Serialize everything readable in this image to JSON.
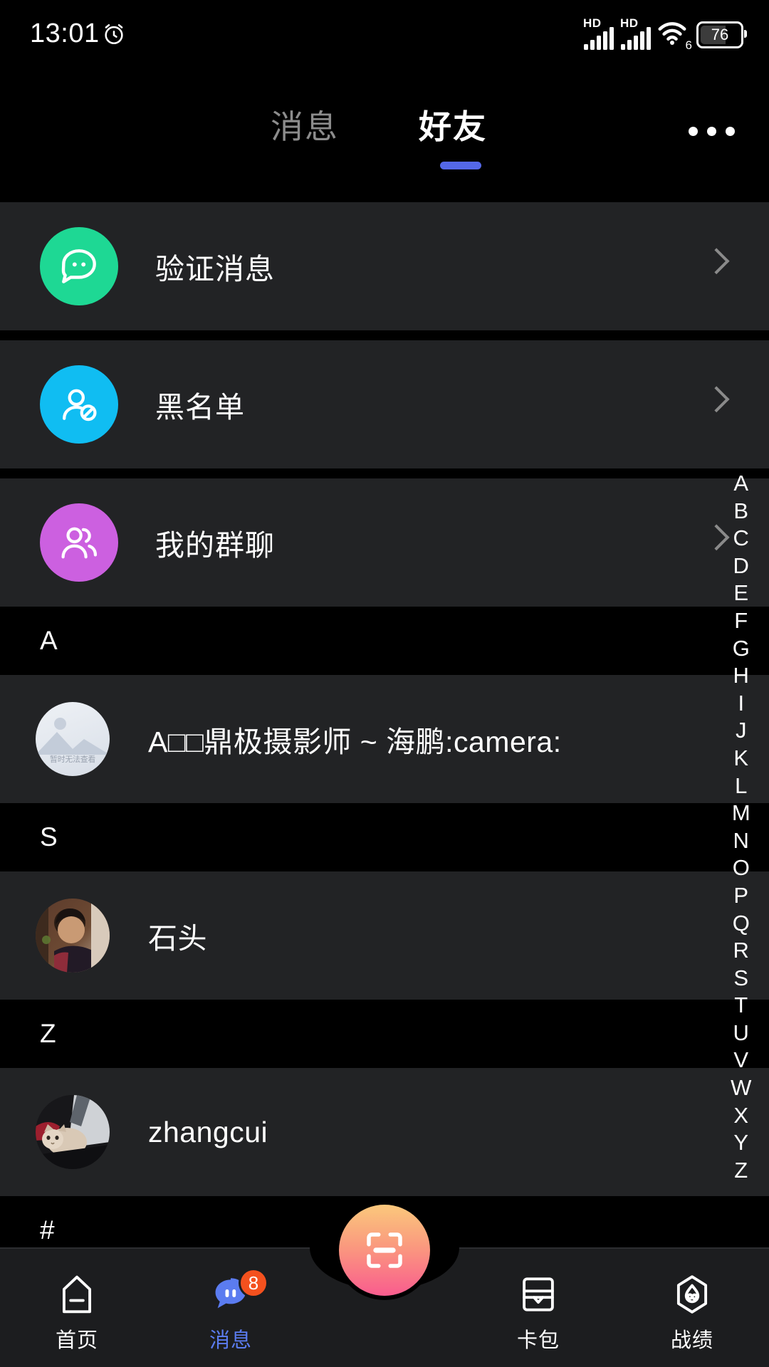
{
  "status_bar": {
    "time": "13:01",
    "alarm_icon": "alarm-icon",
    "sim1_label": "HD",
    "sim2_label": "HD",
    "wifi_icon": "wifi-icon",
    "wifi_generation": "6",
    "battery_level": "76",
    "battery_percent": 76
  },
  "topbar": {
    "tabs": [
      {
        "label": "消息",
        "active": false
      },
      {
        "label": "好友",
        "active": true
      }
    ],
    "more_icon": "more-options-icon",
    "indicator_color": "#5468e8"
  },
  "entries": [
    {
      "label": "验证消息",
      "icon": "verify-message-icon",
      "avatar_color": "#1ed894",
      "chevron": "chevron-right-icon"
    },
    {
      "label": "黑名单",
      "icon": "blacklist-user-icon",
      "avatar_color": "#10bdf2",
      "chevron": "chevron-right-icon"
    },
    {
      "label": "我的群聊",
      "icon": "group-chat-icon",
      "avatar_color": "#cc60e0",
      "chevron": "chevron-right-icon"
    }
  ],
  "sections": [
    {
      "letter": "A",
      "contacts": [
        {
          "name": "A□□鼎极摄影师 ~ 海鹏:camera:",
          "avatar_type": "placeholder",
          "avatar_placeholder_text": "暂时无法查看"
        }
      ]
    },
    {
      "letter": "S",
      "contacts": [
        {
          "name": "石头",
          "avatar_type": "photo-boy"
        }
      ]
    },
    {
      "letter": "Z",
      "contacts": [
        {
          "name": "zhangcui",
          "avatar_type": "photo-cat"
        }
      ]
    },
    {
      "letter": "#",
      "contacts": []
    }
  ],
  "alpha_index": [
    "A",
    "B",
    "C",
    "D",
    "E",
    "F",
    "G",
    "H",
    "I",
    "J",
    "K",
    "L",
    "M",
    "N",
    "O",
    "P",
    "Q",
    "R",
    "S",
    "T",
    "U",
    "V",
    "W",
    "X",
    "Y",
    "Z"
  ],
  "bottom_nav": {
    "items": [
      {
        "label": "首页",
        "icon": "home-icon",
        "active": false,
        "badge": null
      },
      {
        "label": "消息",
        "icon": "message-bubble-icon",
        "active": true,
        "badge": "8"
      },
      {
        "label": "卡包",
        "icon": "card-pack-icon",
        "active": false,
        "badge": null
      },
      {
        "label": "战绩",
        "icon": "records-icon",
        "active": false,
        "badge": null
      }
    ],
    "fab": {
      "icon": "scan-icon",
      "gradient_from": "#fbc87c",
      "gradient_to": "#f95c8e"
    },
    "active_color": "#5b7cf0",
    "badge_color": "#f4511e"
  }
}
